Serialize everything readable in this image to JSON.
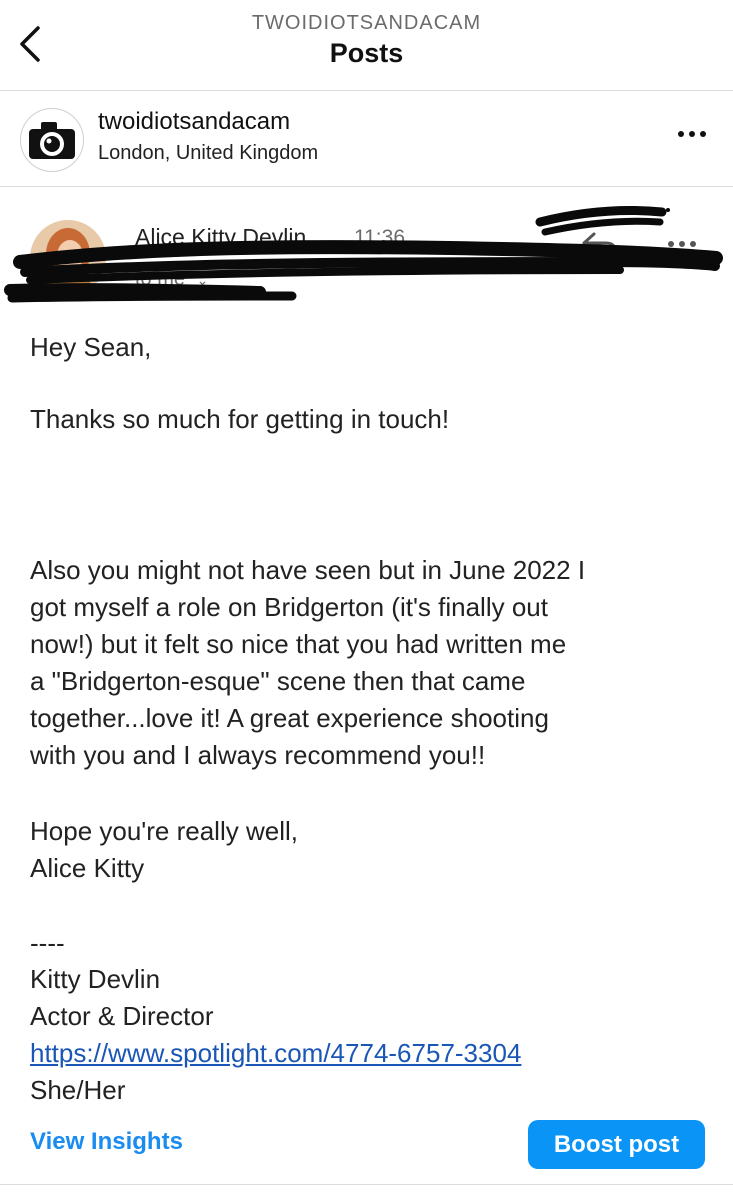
{
  "header": {
    "account_handle_upper": "TWOIDIOTSANDACAM",
    "title": "Posts"
  },
  "post": {
    "username": "twoidiotsandacam",
    "location": "London, United Kingdom"
  },
  "email": {
    "sender_name": "Alice Kitty Devlin",
    "time": "11:36",
    "recipient": "to me",
    "greeting": "Hey Sean,",
    "thanks_line": "Thanks so much for getting in touch!",
    "para2": [
      "Also you might not have seen but in June 2022 I",
      "got myself a role on Bridgerton (it's finally out",
      "now!) but it felt so nice that you had written me",
      "a \"Bridgerton-esque\" scene then that came",
      "together...love it! A great experience shooting",
      "with you and I always recommend you!!"
    ],
    "closing": [
      "Hope you're really well,",
      "Alice Kitty"
    ],
    "signature": {
      "separator": "----",
      "name": "Kitty Devlin",
      "role": "Actor & Director",
      "link": "https://www.spotlight.com/4774-6757-3304",
      "pronouns": "She/Her"
    }
  },
  "actions": {
    "insights_label": "View Insights",
    "boost_label": "Boost post"
  },
  "colors": {
    "link_blue": "#1a56b5",
    "insights_blue": "#1a8cf0",
    "boost_bg": "#0a95f6"
  }
}
